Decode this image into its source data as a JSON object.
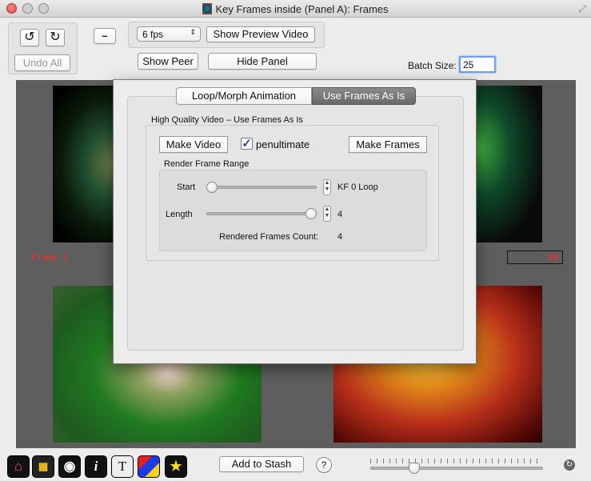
{
  "window": {
    "title": "Key Frames inside (Panel A): Frames"
  },
  "toolbar": {
    "undo_all": "Undo All",
    "minus": "–",
    "fps": "6 fps",
    "show_preview_video": "Show Preview Video",
    "show_peer": "Show Peer",
    "hide_panel": "Hide Panel",
    "batch_size_label": "Batch Size:",
    "batch_size_value": "25"
  },
  "frames": {
    "frame_label": "Frame 1",
    "frame_counter": "80"
  },
  "dialog": {
    "tabs": [
      {
        "label": "Loop/Morph Animation",
        "selected": false
      },
      {
        "label": "Use Frames As Is",
        "selected": true
      }
    ],
    "section_title": "High Quality Video – Use Frames As Is",
    "make_video": "Make Video",
    "penultimate_label": "penultimate",
    "penultimate_checked": true,
    "make_frames": "Make Frames",
    "range_title": "Render Frame Range",
    "start_label": "Start",
    "start_value": "KF 0 Loop",
    "start_level": 0.0,
    "length_label": "Length",
    "length_value": "4",
    "length_level": 1.0,
    "count_label": "Rendered Frames Count:",
    "count_value": "4"
  },
  "bottom": {
    "icons": [
      "home-icon",
      "grid-icon",
      "eye-icon",
      "info-icon",
      "text-icon",
      "color-icon",
      "star-icon"
    ],
    "add_to_stash": "Add to Stash",
    "help": "?",
    "zoom_level": 0.24
  },
  "colors": {
    "accent": "#3b7dd8",
    "frame_text": "#ff2a2a",
    "stage": "#5e5e5e"
  }
}
